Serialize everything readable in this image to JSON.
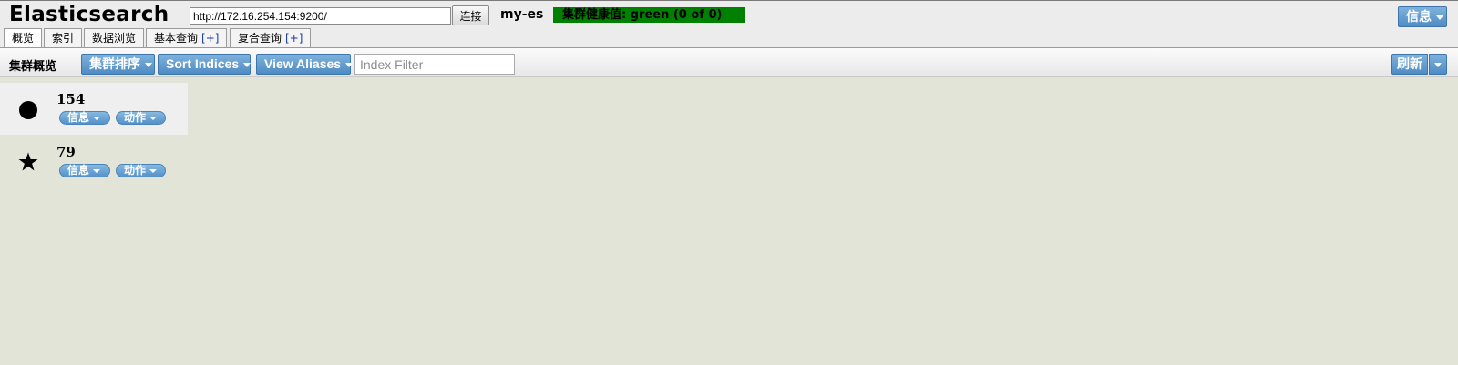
{
  "app": {
    "title": "Elasticsearch"
  },
  "connection": {
    "url": "http://172.16.254.154:9200/",
    "connect_label": "连接"
  },
  "cluster": {
    "name": "my-es",
    "health": "集群健康值: green (0 of 0)"
  },
  "header": {
    "info_label": "信息"
  },
  "tabs": [
    {
      "label": "概览"
    },
    {
      "label": "索引"
    },
    {
      "label": "数据浏览"
    },
    {
      "label": "基本查询",
      "plus": "[+]"
    },
    {
      "label": "复合查询",
      "plus": "[+]"
    }
  ],
  "toolbar": {
    "title": "集群概览",
    "sort_cluster_label": "集群排序",
    "sort_indices_label": "Sort Indices",
    "view_aliases_label": "View Aliases",
    "index_filter_placeholder": "Index Filter",
    "refresh_label": "刷新"
  },
  "nodes": [
    {
      "name": "154",
      "icon": "circle-icon",
      "info_label": "信息",
      "action_label": "动作"
    },
    {
      "name": "79",
      "icon": "star-icon",
      "info_label": "信息",
      "action_label": "动作"
    }
  ],
  "colors": {
    "health_green": "#008000",
    "button_blue": "#5b96cc",
    "background": "#e1e4d7"
  }
}
